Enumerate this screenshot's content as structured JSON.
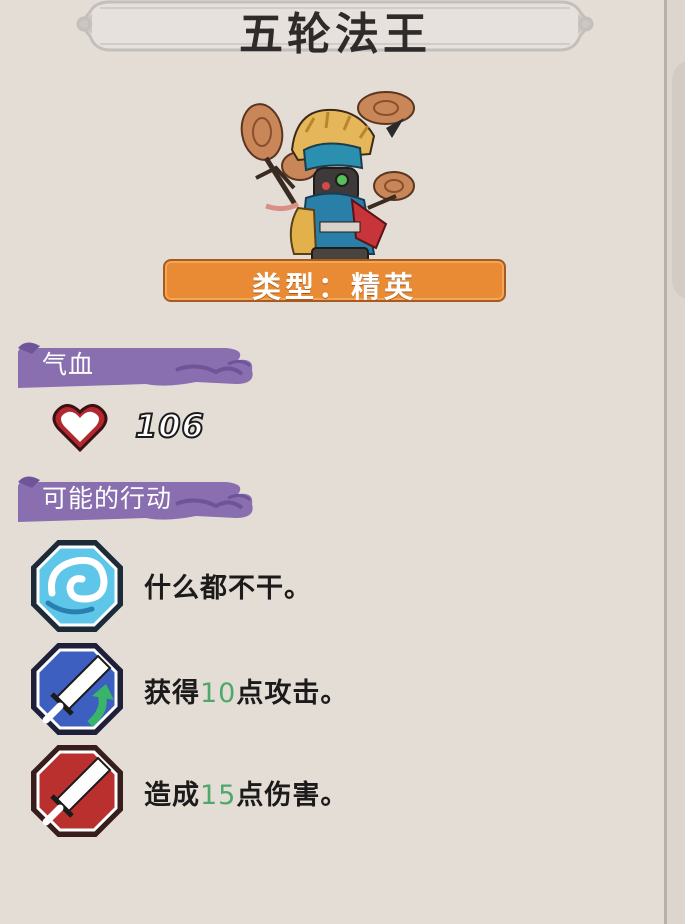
{
  "enemy": {
    "name": "五轮法王",
    "type_label": "类型：精英",
    "portrait_icon": "monk-juggler-portrait"
  },
  "sections": {
    "hp_label": "气血",
    "actions_label": "可能的行动"
  },
  "hp": {
    "value": "106",
    "icon": "heart-icon"
  },
  "actions": [
    {
      "icon": "swirl-wind-icon",
      "parts": [
        "什么都不干。"
      ]
    },
    {
      "icon": "sword-buff-icon",
      "parts": [
        "获得",
        "10",
        "点攻击。"
      ]
    },
    {
      "icon": "sword-attack-icon",
      "parts": [
        "造成",
        "15",
        "点伤害。"
      ]
    }
  ],
  "colors": {
    "background": "#e3ddd6",
    "type_banner": "#e98b34",
    "section_header": "#8a6fb0",
    "number_highlight": "#4ea86c"
  }
}
